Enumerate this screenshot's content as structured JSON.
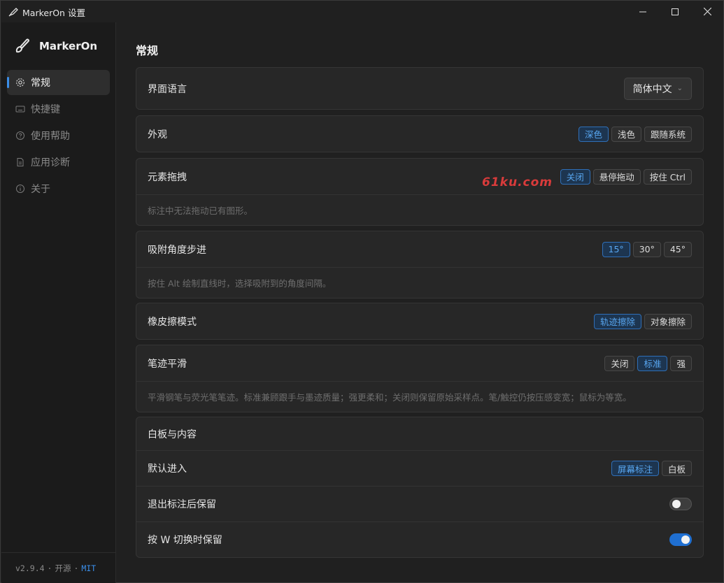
{
  "window": {
    "title": "MarkerOn 设置"
  },
  "sidebar": {
    "brand": "MarkerOn",
    "items": [
      {
        "label": "常规",
        "icon": "gear-icon",
        "active": true
      },
      {
        "label": "快捷键",
        "icon": "keyboard-icon",
        "active": false
      },
      {
        "label": "使用帮助",
        "icon": "help-icon",
        "active": false
      },
      {
        "label": "应用诊断",
        "icon": "document-icon",
        "active": false
      },
      {
        "label": "关于",
        "icon": "info-icon",
        "active": false
      }
    ],
    "footer": {
      "version": "v2.9.4",
      "open_source": "开源",
      "license": "MIT"
    }
  },
  "main": {
    "title": "常规",
    "language": {
      "label": "界面语言",
      "value": "简体中文"
    },
    "appearance": {
      "label": "外观",
      "options": [
        "深色",
        "浅色",
        "跟随系统"
      ],
      "selected": "深色"
    },
    "drag": {
      "label": "元素拖拽",
      "options": [
        "关闭",
        "悬停拖动",
        "按住 Ctrl"
      ],
      "selected": "关闭",
      "description": "标注中无法拖动已有图形。"
    },
    "snap": {
      "label": "吸附角度步进",
      "options": [
        "15°",
        "30°",
        "45°"
      ],
      "selected": "15°",
      "description": "按住 Alt 绘制直线时，选择吸附到的角度间隔。"
    },
    "eraser": {
      "label": "橡皮擦模式",
      "options": [
        "轨迹擦除",
        "对象擦除"
      ],
      "selected": "轨迹擦除"
    },
    "smoothing": {
      "label": "笔迹平滑",
      "options": [
        "关闭",
        "标准",
        "强"
      ],
      "selected": "标准",
      "description": "平滑钢笔与荧光笔笔迹。标准兼顾跟手与墨迹质量；强更柔和；关闭则保留原始采样点。笔/触控仍按压感变宽；鼠标为等宽。"
    },
    "whiteboard": {
      "header": "白板与内容",
      "default_entry": {
        "label": "默认进入",
        "options": [
          "屏幕标注",
          "白板"
        ],
        "selected": "屏幕标注"
      },
      "keep_after_exit": {
        "label": "退出标注后保留",
        "on": false
      },
      "keep_on_w": {
        "label": "按 W 切换时保留",
        "on": true
      }
    }
  },
  "watermark": "61ku.com",
  "colors": {
    "accent": "#3b8ee8",
    "toggle_on": "#1f6fd1"
  }
}
